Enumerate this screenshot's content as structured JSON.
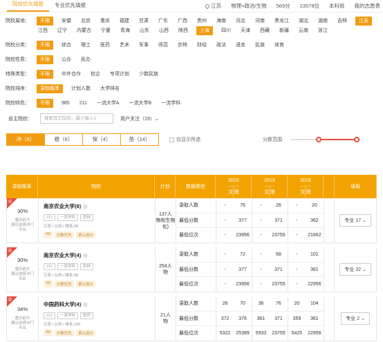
{
  "tabs": {
    "by_school": "院校优先填报",
    "by_major": "专业优先填报"
  },
  "header": {
    "province": "江苏",
    "subjects": "物理+政治/生物",
    "score": "569分",
    "rank": "23578位",
    "level": "本科批",
    "my_plan": "我的志愿表"
  },
  "filters": {
    "region": {
      "label": "院校属地：",
      "options": [
        "不限",
        "安徽",
        "北京",
        "重庆",
        "福建",
        "甘肃",
        "广东",
        "广西",
        "贵州",
        "海南",
        "河北",
        "河南",
        "黑龙江",
        "湖北",
        "湖南",
        "吉林",
        "江苏",
        "江西",
        "辽宁",
        "内蒙古",
        "宁夏",
        "青海",
        "山东",
        "山西",
        "陕西",
        "上海",
        "四川",
        "天津",
        "西藏",
        "新疆",
        "云南",
        "浙江"
      ],
      "selected": [
        "不限",
        "江苏",
        "上海"
      ]
    },
    "category": {
      "label": "院校分类：",
      "options": [
        "不限",
        "综合",
        "理工",
        "医药",
        "艺术",
        "军事",
        "师范",
        "农林",
        "财经",
        "政法",
        "语言",
        "民族",
        "体育"
      ],
      "selected": [
        "不限"
      ]
    },
    "nature": {
      "label": "院校性质：",
      "options": [
        "不限",
        "公办",
        "民办"
      ],
      "selected": [
        "不限"
      ]
    },
    "special": {
      "label": "特殊类型：",
      "options": [
        "不限",
        "中外合作",
        "校企",
        "专项计划",
        "少数民族"
      ],
      "selected": [
        "不限"
      ]
    },
    "sort": {
      "label": "院校排序：",
      "options": [
        "录取概率",
        "计划人数",
        "大学排名"
      ],
      "selected": [
        "录取概率"
      ]
    },
    "feature": {
      "label": "院校特色：",
      "options": [
        "不限",
        "985",
        "211",
        "一流大学A",
        "一流大学B",
        "一流学科"
      ],
      "selected": [
        "不限"
      ]
    }
  },
  "search": {
    "label": "自主院校：",
    "placeholder": "搜索其它院校，最少输入1",
    "follow": "用户关注（19）⌄"
  },
  "segments": [
    {
      "label": "冲（6）",
      "on": true
    },
    {
      "label": "稳（6）",
      "on": false
    },
    {
      "label": "保（4）",
      "on": false
    },
    {
      "label": "垫（14）",
      "on": false
    }
  ],
  "only_filter": "仅显示所选",
  "score_range": {
    "label": "分数范围",
    "low": 0.4,
    "high": 0.95
  },
  "table": {
    "headers": {
      "prob": "录取概率",
      "school": "院校",
      "plan": "计划",
      "data_type": "数据类型",
      "fill": "填报"
    },
    "years": [
      "2020",
      "2019",
      "2018"
    ],
    "sub": [
      "文",
      "理"
    ],
    "row_labels": [
      "录取人数",
      "最低分数",
      "最低位次"
    ],
    "rows": [
      {
        "badge": "冲",
        "prob": "30%",
        "note": "重庆前大\n建议选择冲门\n专业",
        "name": "南京农业大学(8)",
        "eye": "◎",
        "tags": [
          "211",
          "一流学科",
          "农林"
        ],
        "meta": "江苏 / 公办 / 排名:38",
        "tags2": [
          "A8",
          "分数优先",
          "承认加分"
        ],
        "plan": "137人\n物和生物\n化)",
        "data": [
          [
            "-",
            "76",
            "-",
            "26",
            "-",
            "20"
          ],
          [
            "-",
            "377",
            "-",
            "371",
            "-",
            "362"
          ],
          [
            "-",
            "23956",
            "-",
            "23755",
            "-",
            "21662"
          ]
        ],
        "fill": "专业 17 ⌄"
      },
      {
        "badge": "冲",
        "prob": "30%",
        "note": "重庆前大\n建议选择冲门\n专业",
        "name": "南京农业大学(4)",
        "eye": "◎",
        "tags": [
          "211",
          "一流学科",
          "农林"
        ],
        "meta": "江苏 / 公办 / 排名:38",
        "tags2": [
          "A8",
          "分数优先",
          "承认加分"
        ],
        "plan": "254人\n物",
        "data": [
          [
            "-",
            "72",
            "-",
            "68",
            "-",
            "101"
          ],
          [
            "-",
            "377",
            "-",
            "371",
            "-",
            "361"
          ],
          [
            "-",
            "23956",
            "-",
            "23755",
            "-",
            "22956"
          ]
        ],
        "fill": "专业 32 ⌄"
      },
      {
        "badge": "冲",
        "prob": "34%",
        "note": "重庆前大\n建议选择冲门\n专业",
        "name": "中国药科大学(4)",
        "eye": "◎",
        "tags": [
          "211",
          "一流学科",
          "医药"
        ],
        "meta": "江苏 / 公办 / 排名:130",
        "tags2": [
          "A8",
          "分数优先",
          "承认加分"
        ],
        "plan": "21人\n物",
        "data": [
          [
            "26",
            "70",
            "36",
            "76",
            "20",
            "104"
          ],
          [
            "372",
            "376",
            "361",
            "371",
            "359",
            "361"
          ],
          [
            "5322",
            "25389",
            "5933",
            "23755",
            "5425",
            "22956"
          ]
        ],
        "fill": "专业 2 ⌄"
      }
    ]
  }
}
